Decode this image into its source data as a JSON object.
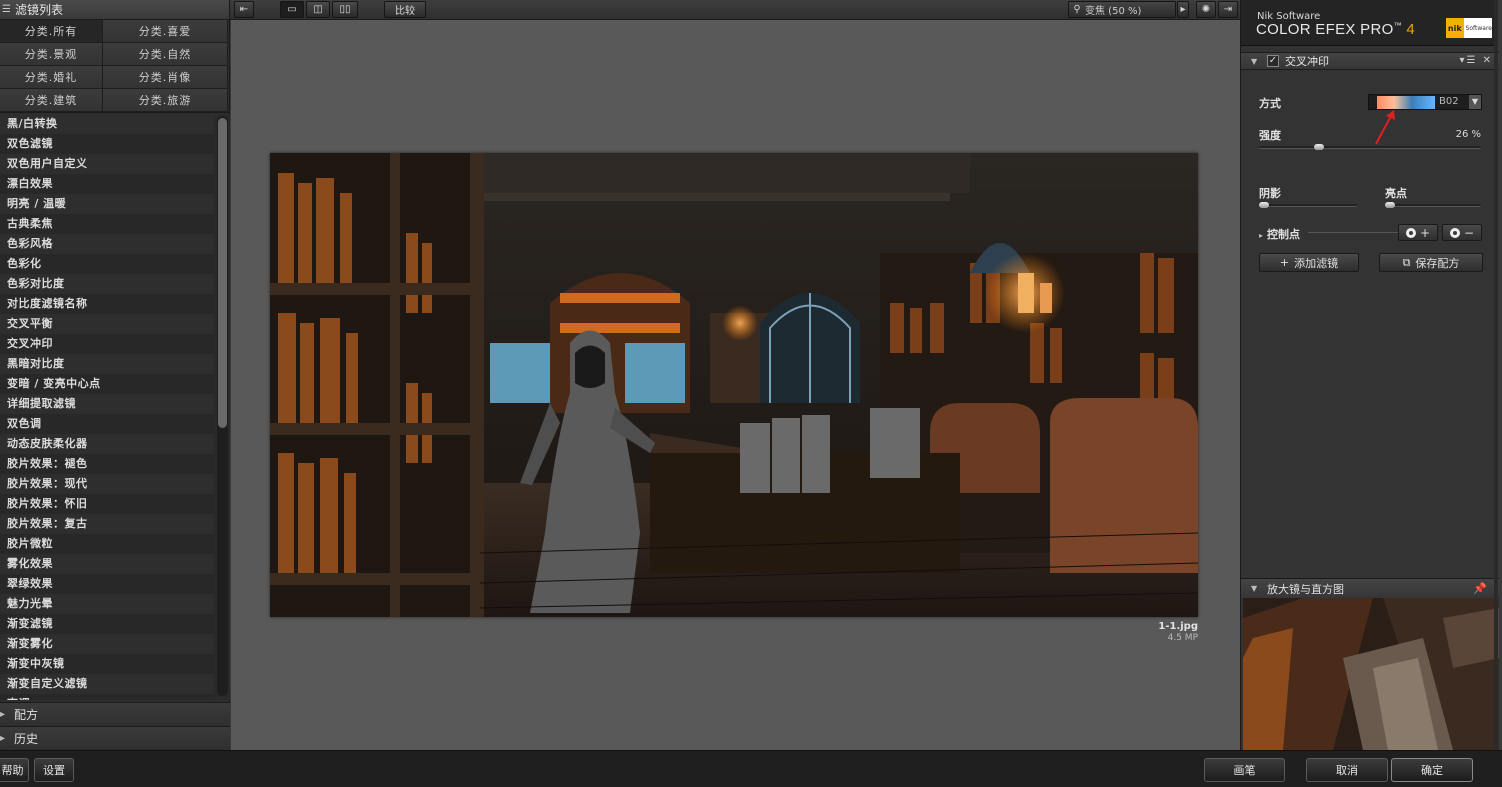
{
  "left": {
    "header": "滤镜列表",
    "categories": [
      "分类.所有",
      "分类.喜爱",
      "分类.景观",
      "分类.自然",
      "分类.婚礼",
      "分类.肖像",
      "分类.建筑",
      "分类.旅游"
    ],
    "filters": [
      "黑/白转换",
      "双色滤镜",
      "双色用户自定义",
      "漂白效果",
      "明亮 / 温暖",
      "古典柔焦",
      "色彩风格",
      "色彩化",
      "色彩对比度",
      "对比度滤镜名称",
      "交叉平衡",
      "交叉冲印",
      "黑暗对比度",
      "变暗 / 变亮中心点",
      "详细提取滤镜",
      "双色调",
      "动态皮肤柔化器",
      "胶片效果：褪色",
      "胶片效果：现代",
      "胶片效果：怀旧",
      "胶片效果：复古",
      "胶片微粒",
      "雾化效果",
      "翠绿效果",
      "魅力光晕",
      "渐变滤镜",
      "渐变雾化",
      "渐变中灰镜",
      "渐变自定义滤镜",
      "高调"
    ],
    "recipes_label": "配方",
    "history_label": "历史"
  },
  "toolbar": {
    "compare_label": "比较",
    "zoom_label": "变焦 (50 %)"
  },
  "canvas": {
    "file_name": "1-1.jpg",
    "file_mp": "4.5 MP"
  },
  "right": {
    "brand_company": "Nik Software",
    "brand_product": "COLOR EFEX PRO",
    "brand_tm": "™",
    "brand_version": "4",
    "nik_logo_text": "nik",
    "nik_logo_sub": "Software",
    "filter_title": "交叉冲印",
    "method_label": "方式",
    "method_value": "B02",
    "strength_label": "强度",
    "strength_value": "26 %",
    "strength_level": 0.26,
    "shadows_label": "阴影",
    "highlights_label": "亮点",
    "control_points_label": "控制点",
    "add_filter_label": "添加滤镜",
    "save_recipe_label": "保存配方",
    "loupe_label": "放大镜与直方图"
  },
  "bottom": {
    "help_label": "帮助",
    "settings_label": "设置",
    "brush_label": "画笔",
    "cancel_label": "取消",
    "ok_label": "确定"
  }
}
